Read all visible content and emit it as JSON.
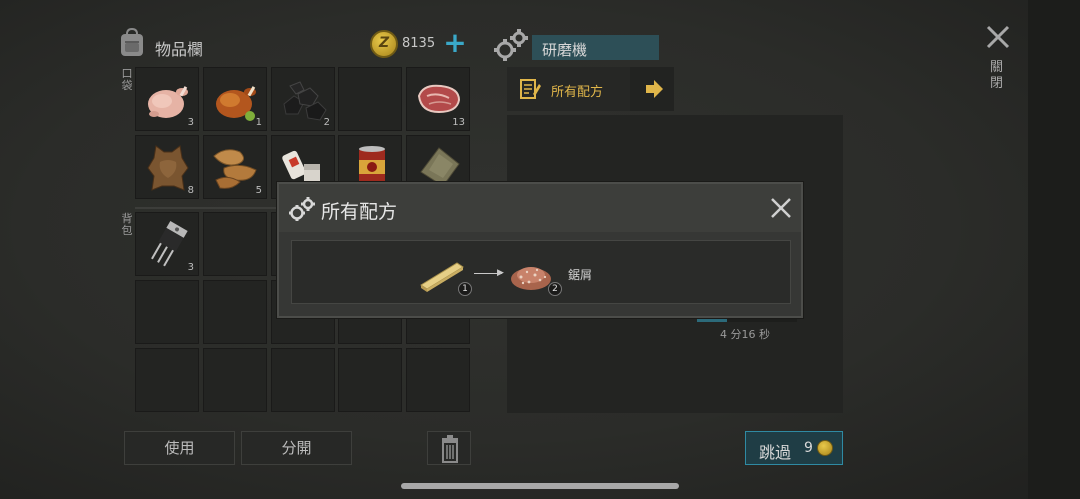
{
  "inventory": {
    "title": "物品欄",
    "coins": "8135",
    "plus": "+",
    "pockets_label": "口袋",
    "backpack_label": "背包",
    "pocket_slots": [
      {
        "item": "raw-chicken",
        "count": "3"
      },
      {
        "item": "roasted-chicken",
        "count": "1"
      },
      {
        "item": "coal",
        "count": "2"
      },
      {
        "item": "empty",
        "count": ""
      },
      {
        "item": "raw-steak",
        "count": "13"
      },
      {
        "item": "leather-hide",
        "count": "8"
      },
      {
        "item": "leather-scraps",
        "count": "5"
      },
      {
        "item": "bandage-pills",
        "count": ""
      },
      {
        "item": "canned-food",
        "count": ""
      },
      {
        "item": "cloth",
        "count": ""
      }
    ],
    "backpack_slots": [
      {
        "item": "transistor",
        "count": "3"
      }
    ]
  },
  "crafting": {
    "station_name": "研磨機",
    "recipe_tab_label": "所有配方",
    "timer": "4 分16 秒"
  },
  "window": {
    "close_label": "關閉"
  },
  "buttons": {
    "use": "使用",
    "split": "分開",
    "skip": "跳過",
    "skip_cost": "9"
  },
  "modal": {
    "title": "所有配方",
    "recipe": {
      "input_count": "1",
      "output_count": "2",
      "output_name": "鋸屑"
    }
  },
  "colors": {
    "accent_teal": "#2f8aa3",
    "recipe_gold": "#e0b64a",
    "background": "#2b2c29"
  }
}
